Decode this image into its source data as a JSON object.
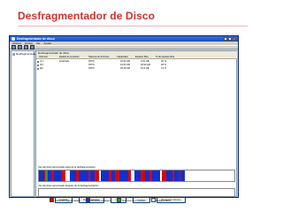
{
  "slide": {
    "title": "Desfragmentador de Disco"
  },
  "window": {
    "title": "Desfragmentador de disco",
    "menu": [
      "Archivo",
      "Acción",
      "Ver",
      "Ayuda"
    ],
    "tree_item": "Desfragmentador de disco",
    "pane_header": "Desfragmentador de disco",
    "columns": [
      "Volumen",
      "Estado de la sesión",
      "Sistema de archivos",
      "Capacidad",
      "Espacio libre",
      "% de espacio libre"
    ],
    "rows": [
      [
        "(C:)",
        "Analizado",
        "NTFS",
        "19,53 GB",
        "3,91 GB",
        "20 %"
      ],
      [
        "(D:)",
        "",
        "NTFS",
        "19,53 GB",
        "18,93 GB",
        "96 %"
      ],
      [
        "(E:)",
        "",
        "NTFS",
        "35,18 GB",
        "5,13 GB",
        "14 %"
      ]
    ],
    "before_label": "Uso del disco aproximado antes de la desfragmentación:",
    "after_label": "Uso del disco aproximado después de la desfragmentación:",
    "buttons": [
      "Analizar",
      "Desfragmentar",
      "Pausar",
      "Detener",
      "Presentar informe"
    ],
    "legend": [
      {
        "label": "Archivos fragmentados",
        "color": "#e00000"
      },
      {
        "label": "Archivos contiguos",
        "color": "#1030d0"
      },
      {
        "label": "Archivos no movibles",
        "color": "#20a020"
      },
      {
        "label": "Espacio libre",
        "color": "#ffffff"
      }
    ]
  }
}
